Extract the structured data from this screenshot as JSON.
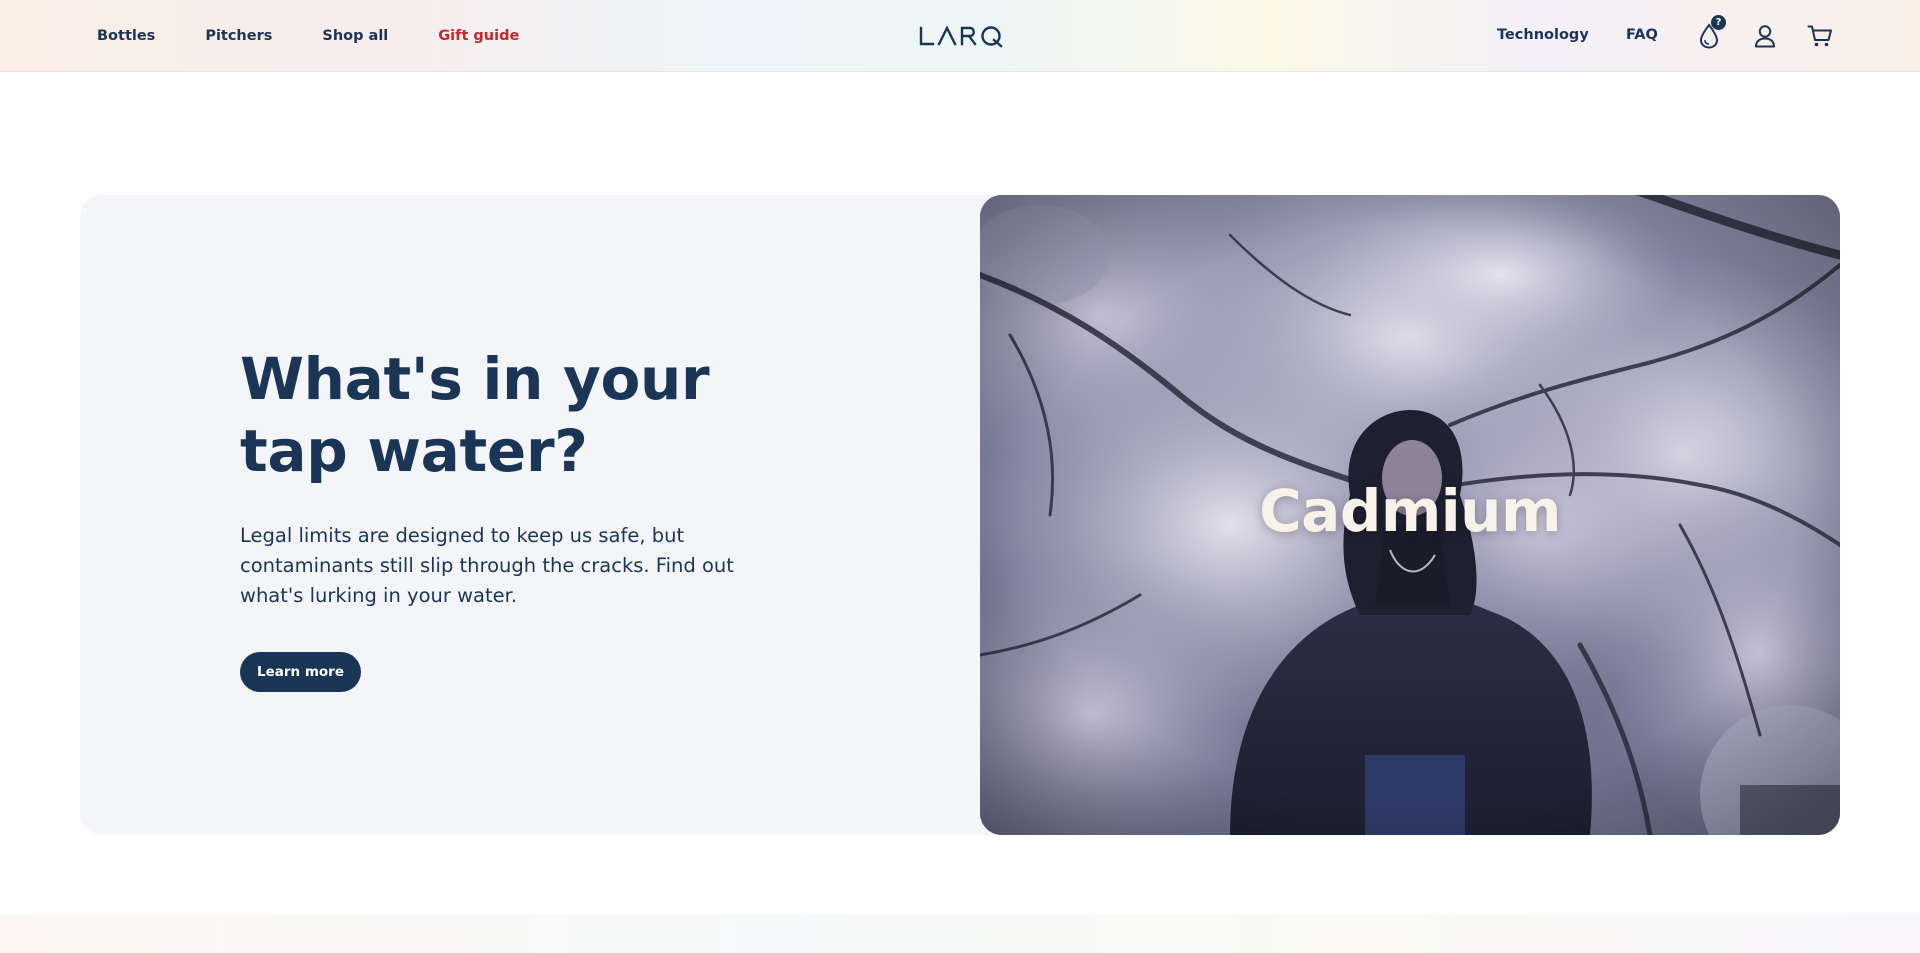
{
  "header": {
    "nav_left": [
      {
        "label": "Bottles"
      },
      {
        "label": "Pitchers"
      },
      {
        "label": "Shop all"
      },
      {
        "label": "Gift guide",
        "color": "#c7262d"
      }
    ],
    "logo_text": "LARQ",
    "nav_right": [
      {
        "label": "Technology"
      },
      {
        "label": "FAQ"
      }
    ],
    "icons": {
      "water_quiz": "water-drop-icon",
      "water_quiz_badge": "?",
      "account": "user-icon",
      "cart": "cart-icon"
    }
  },
  "hero": {
    "title": "What's in your tap water?",
    "body": "Legal limits are designed to keep us safe, but contaminants still slip through the cracks. Find out what's lurking in your water.",
    "cta_label": "Learn more",
    "media_caption": "Cadmium"
  },
  "colors": {
    "brand_navy": "#1b3556",
    "accent_red": "#c7262d",
    "panel_background": "#f4f5f9"
  }
}
